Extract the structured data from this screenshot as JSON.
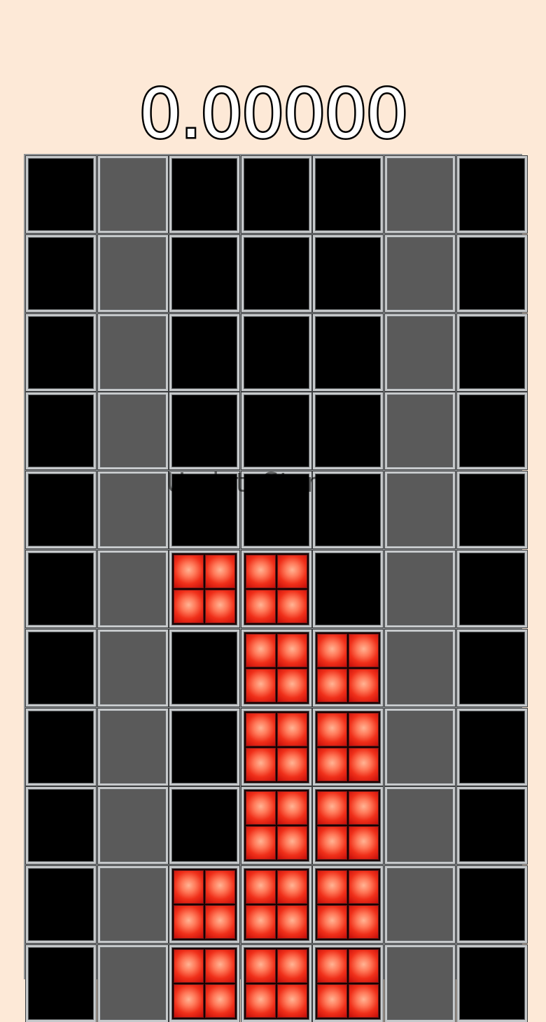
{
  "score": {
    "value": "0.00000"
  },
  "watermark": {
    "text": "UpdateStar.com"
  },
  "board": {
    "columns": 7,
    "visible_rows": 11,
    "cell_types": {
      "black": "#000000",
      "gray": "#5a5a5a",
      "red": "#f0301a"
    },
    "rows": [
      [
        "black",
        "gray",
        "black",
        "black",
        "black",
        "gray",
        "black"
      ],
      [
        "black",
        "gray",
        "black",
        "black",
        "black",
        "gray",
        "black"
      ],
      [
        "black",
        "gray",
        "black",
        "black",
        "black",
        "gray",
        "black"
      ],
      [
        "black",
        "gray",
        "black",
        "black",
        "black",
        "gray",
        "black"
      ],
      [
        "black",
        "gray",
        "black",
        "black",
        "black",
        "gray",
        "black"
      ],
      [
        "black",
        "gray",
        "red",
        "red",
        "black",
        "gray",
        "black"
      ],
      [
        "black",
        "gray",
        "black",
        "red",
        "red",
        "gray",
        "black"
      ],
      [
        "black",
        "gray",
        "black",
        "red",
        "red",
        "gray",
        "black"
      ],
      [
        "black",
        "gray",
        "black",
        "red",
        "red",
        "gray",
        "black"
      ],
      [
        "black",
        "gray",
        "red",
        "red",
        "red",
        "gray",
        "black"
      ],
      [
        "black",
        "gray",
        "red",
        "red",
        "red",
        "gray",
        "black"
      ]
    ]
  }
}
